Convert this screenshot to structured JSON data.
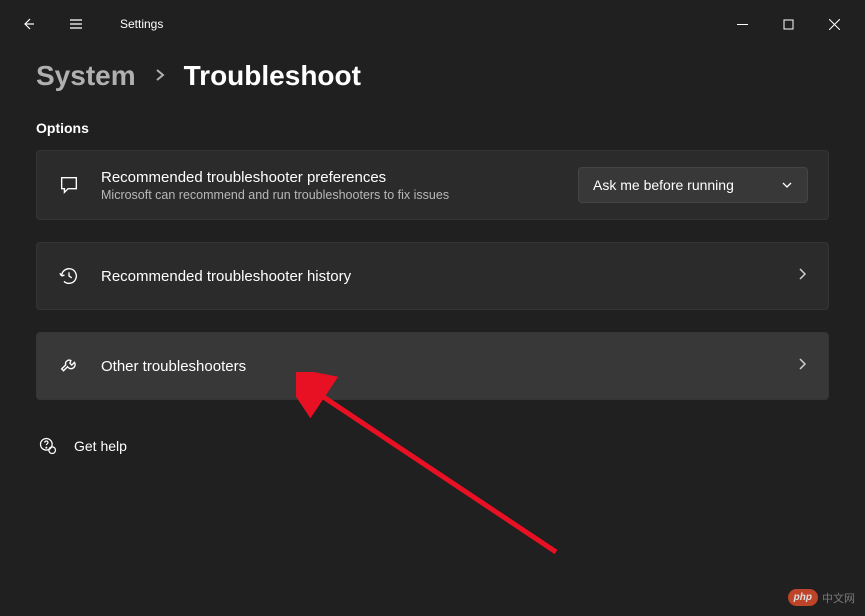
{
  "titlebar": {
    "title": "Settings"
  },
  "breadcrumb": {
    "parent": "System",
    "current": "Troubleshoot"
  },
  "section": {
    "title": "Options"
  },
  "cards": {
    "recommended": {
      "title": "Recommended troubleshooter preferences",
      "subtitle": "Microsoft can recommend and run troubleshooters to fix issues",
      "dropdown_value": "Ask me before running"
    },
    "history": {
      "title": "Recommended troubleshooter history"
    },
    "other": {
      "title": "Other troubleshooters"
    }
  },
  "help": {
    "label": "Get help"
  },
  "watermark": {
    "badge": "php",
    "text": "中文网"
  }
}
